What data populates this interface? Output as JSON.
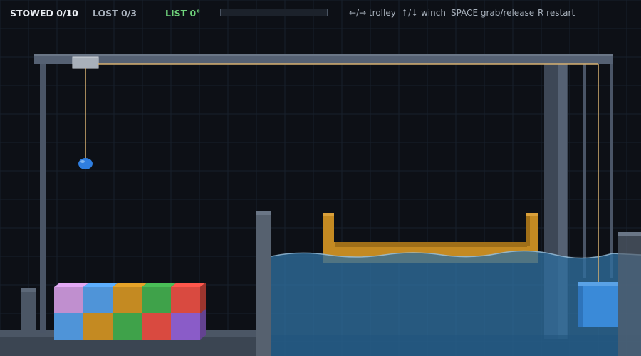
{
  "hud": {
    "stowed_label": "STOWED 0/10",
    "lost_label": "LOST 0/3",
    "list_label": "LIST 0°",
    "list_progress": 0
  },
  "controls": {
    "trolley": "←/→ trolley",
    "winch": "↑/↓ winch",
    "grab": "SPACE grab/release",
    "restart": "R restart"
  },
  "colors": {
    "background": "#0d1016",
    "grid": "#18202c",
    "crane_steel": "#4a5566",
    "cable": "#d6b071",
    "hook": "#2f7ee0",
    "water": "#2f6e9e",
    "ship_hull": "#c48a22",
    "held_container": "#3a8ad8",
    "hud_positive": "#6fd37c"
  },
  "containers": {
    "top_row": [
      "#c08fcf",
      "#4f94d8",
      "#c48a22",
      "#3fa24a",
      "#d94a40"
    ],
    "bottom_row": [
      "#4f94d8",
      "#c48a22",
      "#3fa24a",
      "#d94a40",
      "#8a5cc8"
    ]
  }
}
